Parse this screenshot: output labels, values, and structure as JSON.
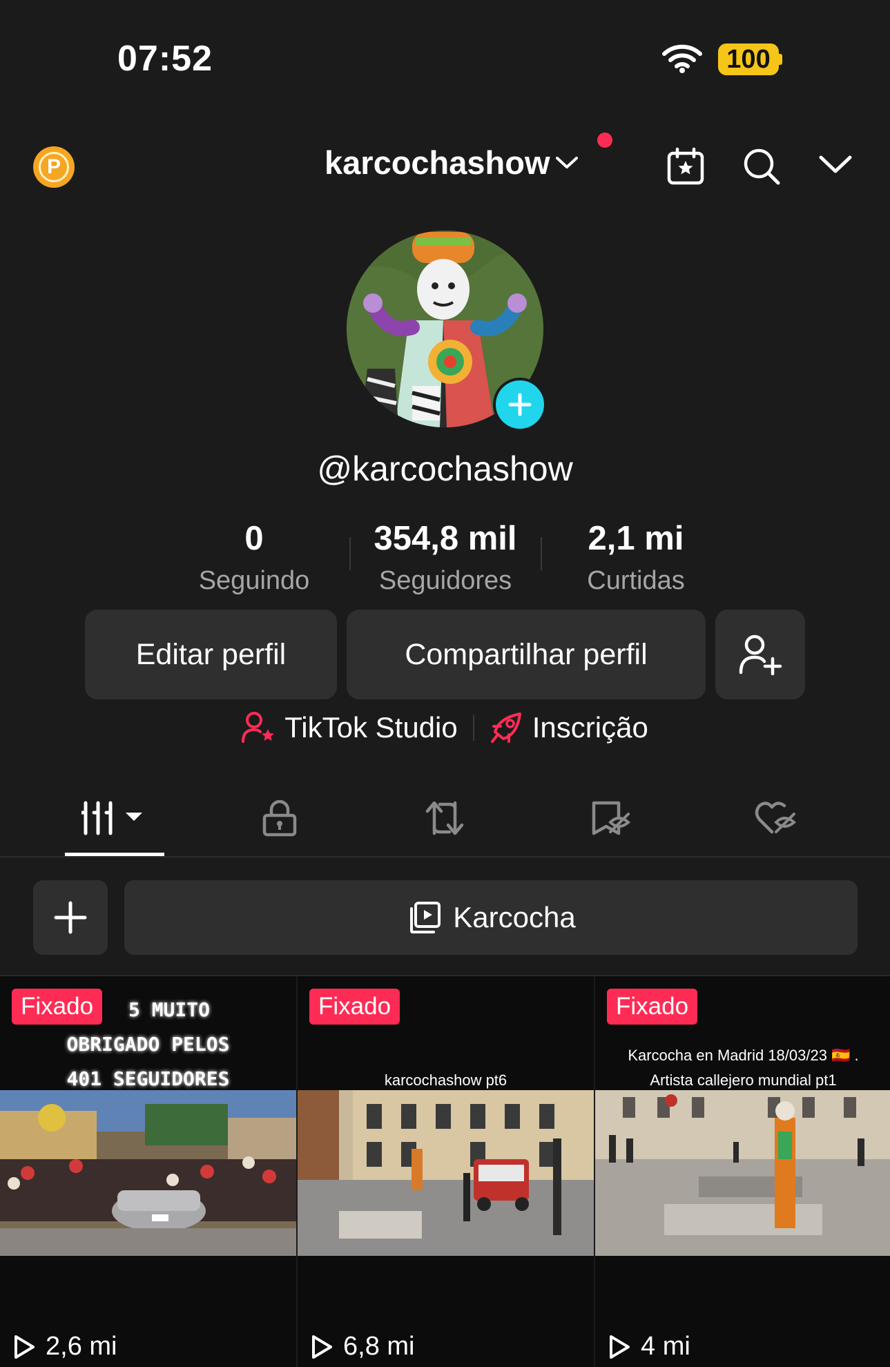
{
  "status_bar": {
    "time": "07:52",
    "battery": "100"
  },
  "header": {
    "username": "karcochashow",
    "coin_label": "P"
  },
  "profile": {
    "handle": "@karcochashow"
  },
  "stats": [
    {
      "value": "0",
      "label": "Seguindo"
    },
    {
      "value": "354,8 mil",
      "label": "Seguidores"
    },
    {
      "value": "2,1 mi",
      "label": "Curtidas"
    }
  ],
  "actions": {
    "edit": "Editar perfil",
    "share": "Compartilhar perfil"
  },
  "links": {
    "studio": "TikTok Studio",
    "subscription": "Inscrição"
  },
  "tabs": [
    "videos-grid-icon",
    "lock-icon",
    "repost-icon",
    "saved-icon",
    "liked-icon"
  ],
  "playlist": {
    "name": "Karcocha"
  },
  "videos": [
    {
      "pinned": "Fixado",
      "views": "2,6 mi",
      "caption_lines": [
        "5 MUITO",
        "OBRIGADO PELOS",
        "401 SEGUIDORES"
      ]
    },
    {
      "pinned": "Fixado",
      "views": "6,8 mi",
      "caption": "karcochashow pt6"
    },
    {
      "pinned": "Fixado",
      "views": "4 mi",
      "caption_lines": [
        "Karcocha en Madrid 18/03/23 🇪🇸 .",
        "Artista callejero mundial pt1"
      ]
    }
  ],
  "colors": {
    "accent": "#fe2c55",
    "avatar_add": "#20d5ec",
    "battery": "#f5c518",
    "coin": "#f5a623"
  }
}
